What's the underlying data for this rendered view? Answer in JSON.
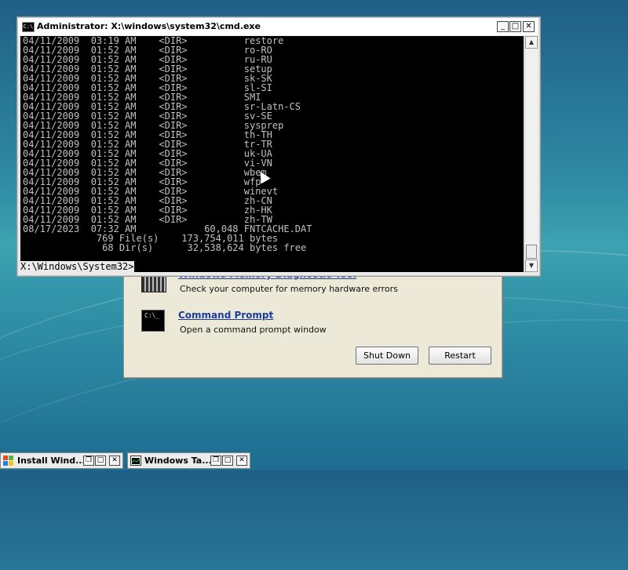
{
  "console": {
    "title": "Administrator: X:\\windows\\system32\\cmd.exe",
    "app_icon": "C:\\",
    "lines": [
      "04/11/2009  03:19 AM    <DIR>          restore",
      "04/11/2009  01:52 AM    <DIR>          ro-RO",
      "04/11/2009  01:52 AM    <DIR>          ru-RU",
      "04/11/2009  01:52 AM    <DIR>          setup",
      "04/11/2009  01:52 AM    <DIR>          sk-SK",
      "04/11/2009  01:52 AM    <DIR>          sl-SI",
      "04/11/2009  01:52 AM    <DIR>          SMI",
      "04/11/2009  01:52 AM    <DIR>          sr-Latn-CS",
      "04/11/2009  01:52 AM    <DIR>          sv-SE",
      "04/11/2009  01:52 AM    <DIR>          sysprep",
      "04/11/2009  01:52 AM    <DIR>          th-TH",
      "04/11/2009  01:52 AM    <DIR>          tr-TR",
      "04/11/2009  01:52 AM    <DIR>          uk-UA",
      "04/11/2009  01:52 AM    <DIR>          vi-VN",
      "04/11/2009  01:52 AM    <DIR>          wbem",
      "04/11/2009  01:52 AM    <DIR>          wfp",
      "04/11/2009  01:52 AM    <DIR>          winevt",
      "04/11/2009  01:52 AM    <DIR>          zh-CN",
      "04/11/2009  01:52 AM    <DIR>          zh-HK",
      "04/11/2009  01:52 AM    <DIR>          zh-TW",
      "08/17/2023  07:32 AM            60,048 FNTCACHE.DAT",
      "             769 File(s)    173,754,011 bytes",
      "              68 Dir(s)      32,538,624 bytes free"
    ],
    "prompt": "X:\\Windows\\System32>"
  },
  "recovery": {
    "items": [
      {
        "title": "Windows Memory Diagnostic Tool",
        "desc": "Check your computer for memory hardware errors",
        "icon": "memory-chip-icon"
      },
      {
        "title": "Command Prompt",
        "desc": "Open a command prompt window",
        "icon": "command-prompt-icon",
        "icon_text": "C:\\_"
      }
    ],
    "shutdown_label": "Shut Down",
    "restart_label": "Restart"
  },
  "taskbar": {
    "windows": [
      {
        "label": "Install Wind...",
        "icon": "windows-setup-icon"
      },
      {
        "label": "Windows Ta...",
        "icon": "task-manager-icon"
      }
    ]
  },
  "colors": {
    "desktop": "#2f8aa3",
    "link": "#1a3c9a",
    "console_bg": "#000000",
    "console_text": "#c0c0c0"
  }
}
